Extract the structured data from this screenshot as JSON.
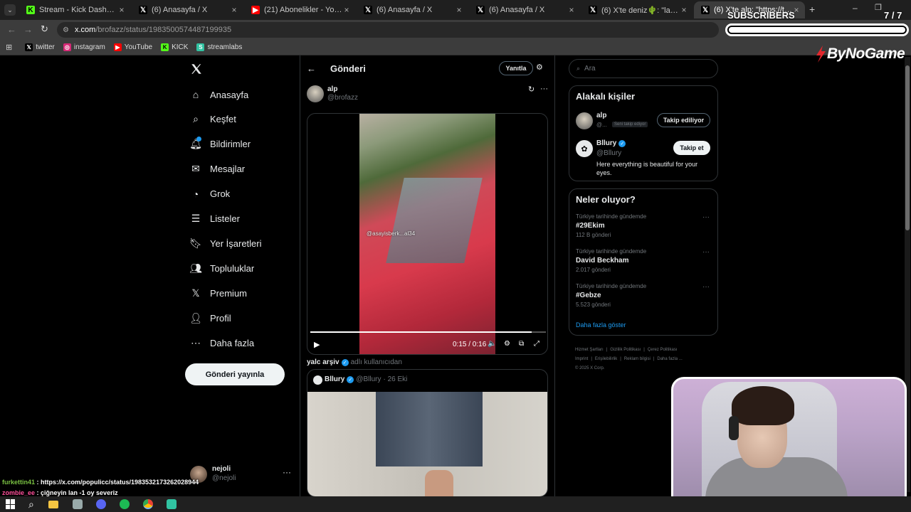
{
  "browser": {
    "tabs": [
      {
        "title": "Stream - Kick Dashboard",
        "icon": "kick-icon"
      },
      {
        "title": "(6) Anasayfa / X",
        "icon": "x-icon"
      },
      {
        "title": "(21) Abonelikler - YouTube",
        "icon": "youtube-icon"
      },
      {
        "title": "(6) Anasayfa / X",
        "icon": "x-icon"
      },
      {
        "title": "(6) Anasayfa / X",
        "icon": "x-icon"
      },
      {
        "title": "(6) X'te deniz🌵: \"lan nejoli ne",
        "icon": "x-icon"
      },
      {
        "title": "(6) X'te alp: \"https://t.co/NAC2...",
        "icon": "x-icon"
      }
    ],
    "url_domain": "x.com",
    "url_path": "/brofazz/status/1983500574487199935",
    "bookmarks": [
      {
        "label": "twitter",
        "icon": "x-icon"
      },
      {
        "label": "instagram",
        "icon": "instagram-icon"
      },
      {
        "label": "YouTube",
        "icon": "youtube-icon"
      },
      {
        "label": "KICK",
        "icon": "kick-icon"
      },
      {
        "label": "streamlabs",
        "icon": "streamlabs-icon"
      }
    ]
  },
  "overlay": {
    "subscribers_label": "SUBSCRIBERS",
    "subscribers_count": "7 / 7",
    "subscribers_progress": 1.0,
    "brand": "ByNoGame",
    "chat": [
      {
        "user": "furkettin41",
        "message": " : https://x.com/populicc/status/1983532173262028944",
        "color": "#7ac142"
      },
      {
        "user": "zombie_ee",
        "message": " : çiğneyin lan -1 oy severiz",
        "color": "#ff4f9a"
      }
    ]
  },
  "nav": {
    "items": [
      {
        "label": "Anasayfa",
        "icon": "home-icon"
      },
      {
        "label": "Keşfet",
        "icon": "search-icon"
      },
      {
        "label": "Bildirimler",
        "icon": "bell-icon"
      },
      {
        "label": "Mesajlar",
        "icon": "mail-icon"
      },
      {
        "label": "Grok",
        "icon": "grok-icon"
      },
      {
        "label": "Listeler",
        "icon": "list-icon"
      },
      {
        "label": "Yer İşaretleri",
        "icon": "bookmark-icon"
      },
      {
        "label": "Topluluklar",
        "icon": "communities-icon"
      },
      {
        "label": "Premium",
        "icon": "x-premium-icon"
      },
      {
        "label": "Profil",
        "icon": "profile-icon"
      },
      {
        "label": "Daha fazla",
        "icon": "more-circle-icon"
      }
    ],
    "post_button": "Gönderi yayınla",
    "account_name": "nejoli",
    "account_handle": "@nejoli"
  },
  "post": {
    "header_title": "Gönderi",
    "reply_button": "Yanıtla",
    "author_name": "alp",
    "author_handle": "@brofazz",
    "video_watermark": "@asayisberk...al34",
    "video_time": "0:15 / 0:16",
    "video_progress": 0.94,
    "source_user": "yalc arşiv",
    "source_suffix": "adlı kullanıcıdan",
    "quoted_name": "Bllury",
    "quoted_handle": "@Bllury",
    "quoted_date": "· 26 Eki"
  },
  "sidebar": {
    "search_placeholder": "Ara",
    "related_title": "Alakalı kişiler",
    "people": [
      {
        "name": "alp",
        "handle": "@...",
        "badge": "Seni takip ediyor",
        "button": "Takip ediliyor",
        "bio": ""
      },
      {
        "name": "Bllury",
        "handle": "@Bllury",
        "badge": "",
        "button": "Takip et",
        "bio": "Here everything is beautiful for your eyes."
      }
    ],
    "trends_title": "Neler oluyor?",
    "trends": [
      {
        "context": "Türkiye tarihinde gündemde",
        "name": "#29Ekim",
        "count": "112 B gönderi"
      },
      {
        "context": "Türkiye tarihinde gündemde",
        "name": "David Beckham",
        "count": "2.017 gönderi"
      },
      {
        "context": "Türkiye tarihinde gündemde",
        "name": "#Gebze",
        "count": "5.523 gönderi"
      }
    ],
    "show_more": "Daha fazla göster",
    "footer_row1": [
      "Hizmet Şartları",
      "Gizlilik Politikası",
      "Çerez Politikası"
    ],
    "footer_row2": [
      "Imprint",
      "Erişilebilirlik",
      "Reklam bilgisi",
      "Daha fazla ..."
    ],
    "copyright": "© 2025 X Corp."
  },
  "colors": {
    "accent": "#1d9bf0",
    "bg": "#000000",
    "border": "#2f3336",
    "kick": "#53fc18",
    "youtube": "#ff0000"
  }
}
